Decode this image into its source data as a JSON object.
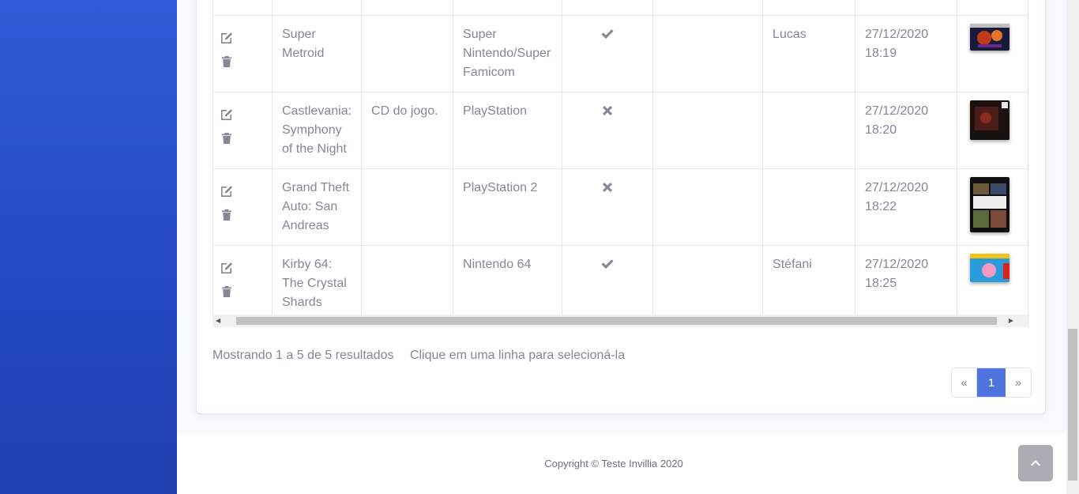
{
  "colors": {
    "sidebar": "#2f5bd8",
    "primary": "#4e73df",
    "text": "#858796"
  },
  "table": {
    "rows": [
      {
        "name": "Super Metroid",
        "description": "",
        "platform": "Super Nintendo/Super Famicom",
        "status": "check-icon",
        "user": "Lucas",
        "date": "27/12/2020 18:19",
        "cover": "super-metroid-cover"
      },
      {
        "name": "Castlevania: Symphony of the Night",
        "description": "CD do jogo.",
        "platform": "PlayStation",
        "status": "times-icon",
        "user": "",
        "date": "27/12/2020 18:20",
        "cover": "castlevania-cover"
      },
      {
        "name": "Grand Theft Auto: San Andreas",
        "description": "",
        "platform": "PlayStation 2",
        "status": "times-icon",
        "user": "",
        "date": "27/12/2020 18:22",
        "cover": "gta-san-andreas-cover"
      },
      {
        "name": "Kirby 64: The Crystal Shards",
        "description": "",
        "platform": "Nintendo 64",
        "status": "check-icon",
        "user": "Stéfani",
        "date": "27/12/2020 18:25",
        "cover": "kirby-64-cover"
      }
    ]
  },
  "info": {
    "showing": "Mostrando 1 a 5 de 5 resultados",
    "hint": "Clique em uma linha para selecioná-la"
  },
  "pagination": {
    "prev": "«",
    "current": "1",
    "next": "»"
  },
  "footer": {
    "copyright": "Copyright © Teste Invillia 2020"
  }
}
